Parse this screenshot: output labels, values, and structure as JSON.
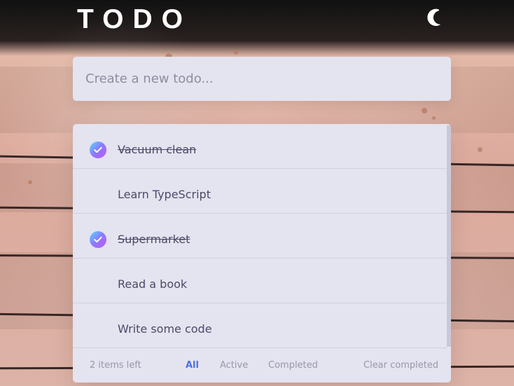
{
  "header": {
    "title": "TODO",
    "theme_icon": "moon-icon"
  },
  "new_todo": {
    "placeholder": "Create a new todo..."
  },
  "todos": [
    {
      "text": "Vacuum clean",
      "completed": true
    },
    {
      "text": "Learn TypeScript",
      "completed": false
    },
    {
      "text": "Supermarket",
      "completed": true
    },
    {
      "text": "Read a book",
      "completed": false
    },
    {
      "text": "Write some code",
      "completed": false
    }
  ],
  "footer": {
    "items_left": "2 items left",
    "filters": [
      "All",
      "Active",
      "Completed"
    ],
    "active_filter": "All",
    "clear_completed": "Clear completed"
  },
  "colors": {
    "accent_blue": "#4c73df",
    "panel_bg": "#e4e3f0",
    "text_main": "#4a4b67",
    "text_muted": "#9a98aa",
    "check_gradient_start": "#55ddff",
    "check_gradient_end": "#c058f3"
  }
}
